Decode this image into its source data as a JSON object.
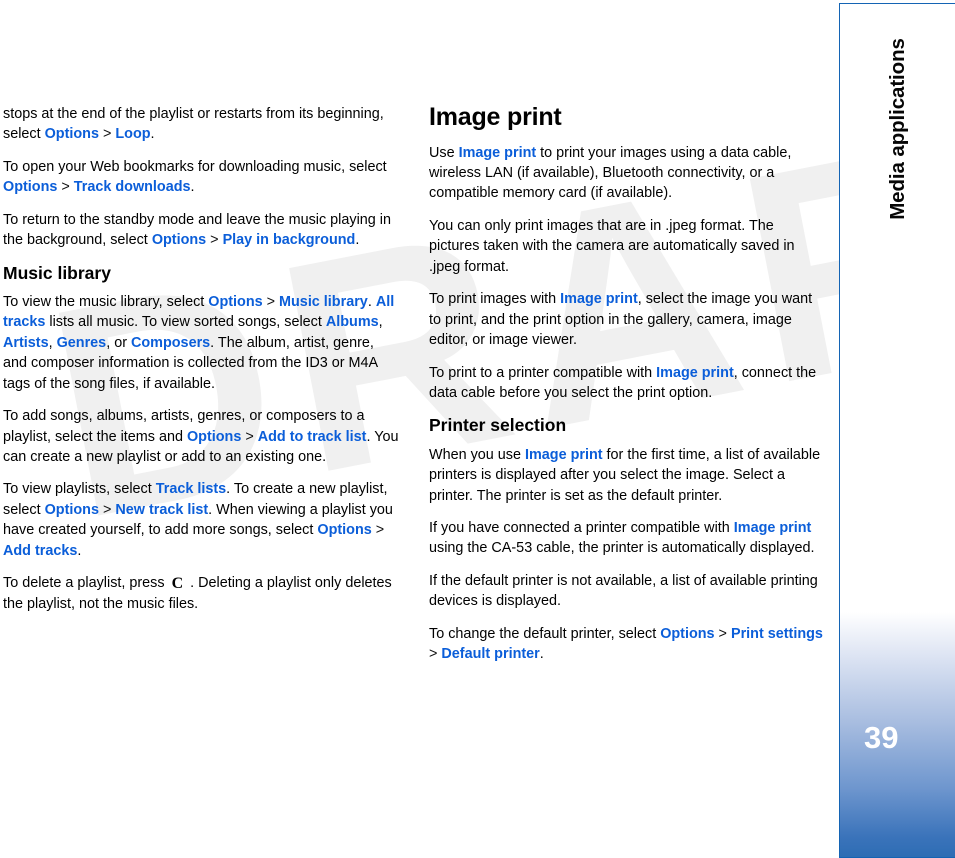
{
  "page": {
    "number": "39",
    "watermark": "DRAFT",
    "sidebar_label": "Media applications",
    "accent_color": "#0b5ed9",
    "sidebar_border_color": "#1464b4",
    "sidebar_gradient_bottom": "#2e6db4"
  },
  "left_column": {
    "p1": {
      "t1": "stops at the end of the playlist or restarts from its beginning, select ",
      "l1": "Options",
      "sep1": " > ",
      "l2": "Loop",
      "t2": "."
    },
    "p2": {
      "t1": "To open your Web bookmarks for downloading music, select ",
      "l1": "Options",
      "sep1": " > ",
      "l2": "Track downloads",
      "t2": "."
    },
    "p3": {
      "t1": "To return to the standby mode and leave the music playing in the background, select ",
      "l1": "Options",
      "sep1": " > ",
      "l2": "Play in background",
      "t2": "."
    },
    "heading_music_library": "Music library",
    "p4": {
      "t1": "To view the music library, select ",
      "l1": "Options",
      "sep1": " > ",
      "l2": "Music library",
      "t2": ". ",
      "l3": "All tracks",
      "t3": " lists all music. To view sorted songs, select ",
      "l4": "Albums",
      "t4": ", ",
      "l5": "Artists",
      "t5": ", ",
      "l6": "Genres",
      "t6": ", or ",
      "l7": "Composers",
      "t7": ". The album, artist, genre, and composer information is collected from the ID3 or M4A tags of the song files, if available."
    },
    "p5": {
      "t1": "To add songs, albums, artists, genres, or composers to a playlist, select the items and ",
      "l1": "Options",
      "sep1": " > ",
      "l2": "Add to track list",
      "t2": ". You can create a new playlist or add to an existing one."
    },
    "p6": {
      "t1": "To view playlists, select ",
      "l1": "Track lists",
      "t2": ". To create a new playlist, select ",
      "l2": "Options",
      "sep1": " > ",
      "l3": "New track list",
      "t3": ". When viewing a playlist you have created yourself, to add more songs, select ",
      "l4": "Options",
      "sep2": " > ",
      "l5": "Add tracks",
      "t4": "."
    },
    "p7": {
      "t1": "To delete a playlist, press ",
      "key_icon": "C",
      "t2": " . Deleting a playlist only deletes the playlist, not the music files."
    }
  },
  "right_column": {
    "heading_image_print": "Image print",
    "p1": {
      "t1": "Use ",
      "l1": "Image print",
      "t2": " to print your images using a data cable, wireless LAN (if available), Bluetooth connectivity, or a compatible memory card (if available)."
    },
    "p2": {
      "t1": "You can only print images that are in .jpeg format. The pictures taken with the camera are automatically saved in .jpeg format."
    },
    "p3": {
      "t1": "To print images with ",
      "l1": "Image print",
      "t2": ", select the image you want to print, and the print option in the gallery, camera, image editor, or image viewer."
    },
    "p4": {
      "t1": "To print to a printer compatible with ",
      "l1": "Image print",
      "t2": ", connect the data cable before you select the print option."
    },
    "heading_printer_selection": "Printer selection",
    "p5": {
      "t1": "When you use ",
      "l1": "Image print",
      "t2": " for the first time, a list of available printers is displayed after you select the image. Select a printer. The printer is set as the default printer."
    },
    "p6": {
      "t1": "If you have connected a printer compatible with ",
      "l1": "Image print",
      "t2": " using the CA-53 cable, the printer is automatically displayed."
    },
    "p7": {
      "t1": "If the default printer is not available, a list of available printing devices is displayed."
    },
    "p8": {
      "t1": "To change the default printer, select ",
      "l1": "Options",
      "sep1": " > ",
      "l2": "Print settings",
      "sep2": " > ",
      "l3": "Default printer",
      "t2": "."
    }
  }
}
